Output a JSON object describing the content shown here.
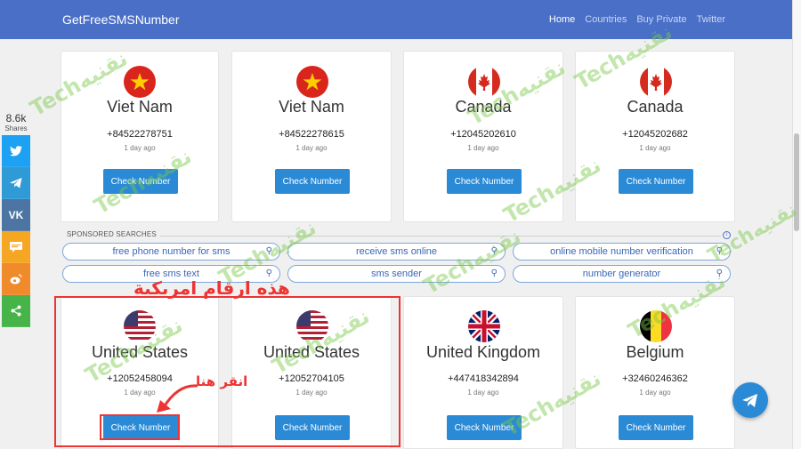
{
  "navbar": {
    "brand": "GetFreeSMSNumber",
    "links": [
      "Home",
      "Countries",
      "Buy Private",
      "Twitter"
    ]
  },
  "share": {
    "count": "8.6k",
    "label": "Shares",
    "buttons": [
      {
        "icon": "twitter-icon",
        "color": "#1da1f2"
      },
      {
        "icon": "telegram-icon",
        "color": "#2e9bd6"
      },
      {
        "icon": "vk-icon",
        "color": "#4c75a3"
      },
      {
        "icon": "sms-icon",
        "color": "#f5a623"
      },
      {
        "icon": "weibo-icon",
        "color": "#ef8b2b"
      },
      {
        "icon": "share-icon",
        "color": "#47b44a"
      }
    ]
  },
  "cards_top": [
    {
      "country": "Viet Nam",
      "number": "+84522278751",
      "ago": "1 day ago",
      "button": "Check Number"
    },
    {
      "country": "Viet Nam",
      "number": "+84522278615",
      "ago": "1 day ago",
      "button": "Check Number"
    },
    {
      "country": "Canada",
      "number": "+12045202610",
      "ago": "1 day ago",
      "button": "Check Number"
    },
    {
      "country": "Canada",
      "number": "+12045202682",
      "ago": "1 day ago",
      "button": "Check Number"
    }
  ],
  "sponsored": {
    "title": "SPONSORED SEARCHES",
    "items": [
      "free phone number for sms",
      "receive sms online",
      "online mobile number verification",
      "free sms text",
      "sms sender",
      "number generator"
    ]
  },
  "cards_bottom": [
    {
      "country": "United States",
      "number": "+12052458094",
      "ago": "1 day ago",
      "button": "Check Number"
    },
    {
      "country": "United States",
      "number": "+12052704105",
      "ago": "1 day ago",
      "button": "Check Number"
    },
    {
      "country": "United Kingdom",
      "number": "+447418342894",
      "ago": "1 day ago",
      "button": "Check Number"
    },
    {
      "country": "Belgium",
      "number": "+32460246362",
      "ago": "1 day ago",
      "button": "Check Number"
    }
  ],
  "annotations": {
    "american_numbers": "هذه ارقام امريكية",
    "click_here": "انقر هنا"
  },
  "watermark": "Techنقنيه"
}
